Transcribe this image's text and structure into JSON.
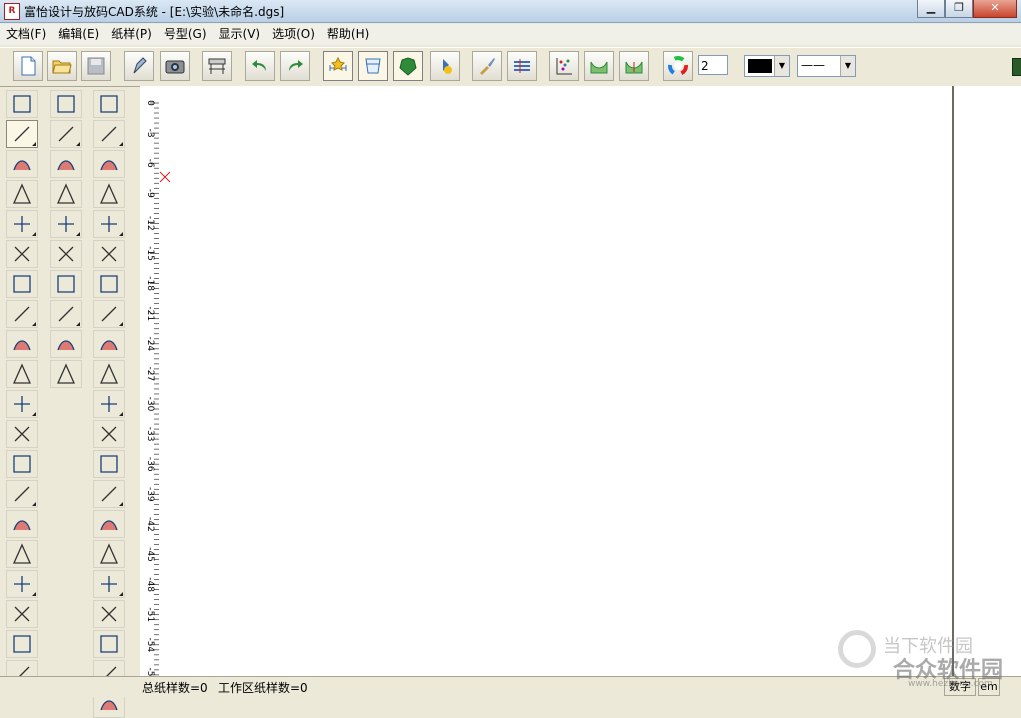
{
  "window": {
    "title": "富怡设计与放码CAD系统 - [E:\\实验\\未命名.dgs]",
    "icon_text": "R",
    "minimize": "▁",
    "maximize": "❐",
    "close": "✕"
  },
  "menu": [
    "文档(F)",
    "编辑(E)",
    "纸样(P)",
    "号型(G)",
    "显示(V)",
    "选项(O)",
    "帮助(H)"
  ],
  "toolbar": {
    "number_value": "2",
    "color_swatch": "#000000",
    "line_style_label": "——",
    "combo_arrow": "▼"
  },
  "ruler": {
    "labels": [
      "0",
      "-3",
      "-6",
      "-9",
      "-12",
      "-15",
      "-18",
      "-21",
      "-24",
      "-27",
      "-30",
      "-33",
      "-36",
      "-39",
      "-42",
      "-45",
      "-48",
      "-51",
      "-54",
      "-57"
    ]
  },
  "status": {
    "total_patterns": "总纸样数=0",
    "work_patterns": "工作区纸样数=0",
    "mode": "数字",
    "caps": "em"
  },
  "watermark": {
    "line1": "当下软件园",
    "line2": "合众软件园",
    "site": "www.hezhong.com"
  },
  "colors": {
    "accent_blue": "#3b6fb6",
    "icon_green": "#2e8b3a",
    "marker_red": "#d02020"
  }
}
